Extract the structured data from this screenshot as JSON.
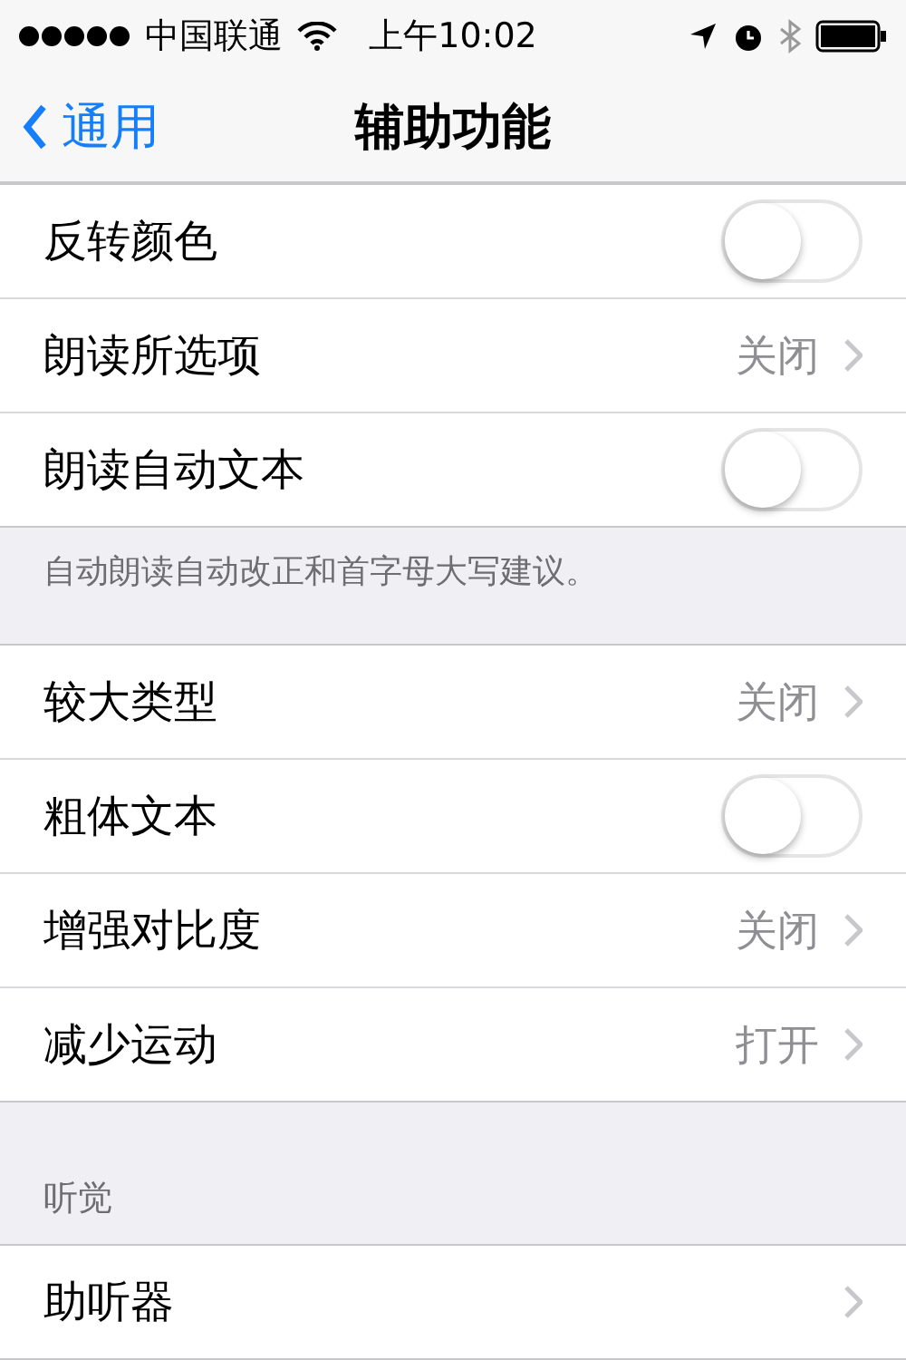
{
  "status_bar": {
    "carrier": "中国联通",
    "time": "上午10:02"
  },
  "nav_bar": {
    "back": "通用",
    "title": "辅助功能"
  },
  "sections": [
    {
      "rows": [
        {
          "kind": "toggle",
          "label": "反转颜色",
          "on": false
        },
        {
          "kind": "value",
          "label": "朗读所选项",
          "value": "关闭"
        },
        {
          "kind": "toggle",
          "label": "朗读自动文本",
          "on": false
        }
      ],
      "footer": "自动朗读自动改正和首字母大写建议。"
    },
    {
      "rows": [
        {
          "kind": "value",
          "label": "较大类型",
          "value": "关闭"
        },
        {
          "kind": "toggle",
          "label": "粗体文本",
          "on": false
        },
        {
          "kind": "value",
          "label": "增强对比度",
          "value": "关闭"
        },
        {
          "kind": "value",
          "label": "减少运动",
          "value": "打开"
        }
      ]
    },
    {
      "header": "听觉",
      "rows": [
        {
          "kind": "value",
          "label": "助听器"
        }
      ]
    }
  ]
}
